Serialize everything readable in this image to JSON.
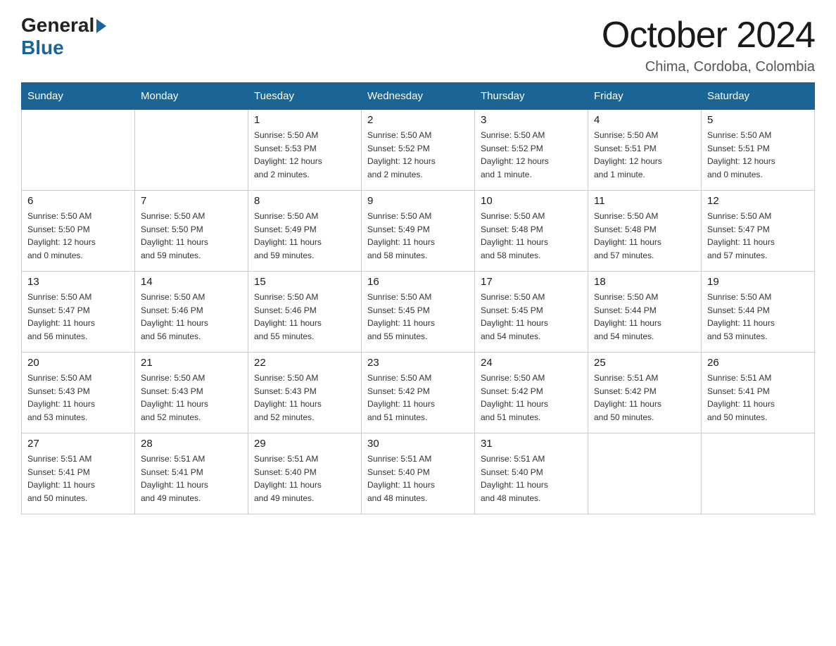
{
  "header": {
    "month_title": "October 2024",
    "location": "Chima, Cordoba, Colombia",
    "logo_general": "General",
    "logo_blue": "Blue"
  },
  "days_of_week": [
    "Sunday",
    "Monday",
    "Tuesday",
    "Wednesday",
    "Thursday",
    "Friday",
    "Saturday"
  ],
  "weeks": [
    [
      {
        "day": "",
        "info": ""
      },
      {
        "day": "",
        "info": ""
      },
      {
        "day": "1",
        "info": "Sunrise: 5:50 AM\nSunset: 5:53 PM\nDaylight: 12 hours\nand 2 minutes."
      },
      {
        "day": "2",
        "info": "Sunrise: 5:50 AM\nSunset: 5:52 PM\nDaylight: 12 hours\nand 2 minutes."
      },
      {
        "day": "3",
        "info": "Sunrise: 5:50 AM\nSunset: 5:52 PM\nDaylight: 12 hours\nand 1 minute."
      },
      {
        "day": "4",
        "info": "Sunrise: 5:50 AM\nSunset: 5:51 PM\nDaylight: 12 hours\nand 1 minute."
      },
      {
        "day": "5",
        "info": "Sunrise: 5:50 AM\nSunset: 5:51 PM\nDaylight: 12 hours\nand 0 minutes."
      }
    ],
    [
      {
        "day": "6",
        "info": "Sunrise: 5:50 AM\nSunset: 5:50 PM\nDaylight: 12 hours\nand 0 minutes."
      },
      {
        "day": "7",
        "info": "Sunrise: 5:50 AM\nSunset: 5:50 PM\nDaylight: 11 hours\nand 59 minutes."
      },
      {
        "day": "8",
        "info": "Sunrise: 5:50 AM\nSunset: 5:49 PM\nDaylight: 11 hours\nand 59 minutes."
      },
      {
        "day": "9",
        "info": "Sunrise: 5:50 AM\nSunset: 5:49 PM\nDaylight: 11 hours\nand 58 minutes."
      },
      {
        "day": "10",
        "info": "Sunrise: 5:50 AM\nSunset: 5:48 PM\nDaylight: 11 hours\nand 58 minutes."
      },
      {
        "day": "11",
        "info": "Sunrise: 5:50 AM\nSunset: 5:48 PM\nDaylight: 11 hours\nand 57 minutes."
      },
      {
        "day": "12",
        "info": "Sunrise: 5:50 AM\nSunset: 5:47 PM\nDaylight: 11 hours\nand 57 minutes."
      }
    ],
    [
      {
        "day": "13",
        "info": "Sunrise: 5:50 AM\nSunset: 5:47 PM\nDaylight: 11 hours\nand 56 minutes."
      },
      {
        "day": "14",
        "info": "Sunrise: 5:50 AM\nSunset: 5:46 PM\nDaylight: 11 hours\nand 56 minutes."
      },
      {
        "day": "15",
        "info": "Sunrise: 5:50 AM\nSunset: 5:46 PM\nDaylight: 11 hours\nand 55 minutes."
      },
      {
        "day": "16",
        "info": "Sunrise: 5:50 AM\nSunset: 5:45 PM\nDaylight: 11 hours\nand 55 minutes."
      },
      {
        "day": "17",
        "info": "Sunrise: 5:50 AM\nSunset: 5:45 PM\nDaylight: 11 hours\nand 54 minutes."
      },
      {
        "day": "18",
        "info": "Sunrise: 5:50 AM\nSunset: 5:44 PM\nDaylight: 11 hours\nand 54 minutes."
      },
      {
        "day": "19",
        "info": "Sunrise: 5:50 AM\nSunset: 5:44 PM\nDaylight: 11 hours\nand 53 minutes."
      }
    ],
    [
      {
        "day": "20",
        "info": "Sunrise: 5:50 AM\nSunset: 5:43 PM\nDaylight: 11 hours\nand 53 minutes."
      },
      {
        "day": "21",
        "info": "Sunrise: 5:50 AM\nSunset: 5:43 PM\nDaylight: 11 hours\nand 52 minutes."
      },
      {
        "day": "22",
        "info": "Sunrise: 5:50 AM\nSunset: 5:43 PM\nDaylight: 11 hours\nand 52 minutes."
      },
      {
        "day": "23",
        "info": "Sunrise: 5:50 AM\nSunset: 5:42 PM\nDaylight: 11 hours\nand 51 minutes."
      },
      {
        "day": "24",
        "info": "Sunrise: 5:50 AM\nSunset: 5:42 PM\nDaylight: 11 hours\nand 51 minutes."
      },
      {
        "day": "25",
        "info": "Sunrise: 5:51 AM\nSunset: 5:42 PM\nDaylight: 11 hours\nand 50 minutes."
      },
      {
        "day": "26",
        "info": "Sunrise: 5:51 AM\nSunset: 5:41 PM\nDaylight: 11 hours\nand 50 minutes."
      }
    ],
    [
      {
        "day": "27",
        "info": "Sunrise: 5:51 AM\nSunset: 5:41 PM\nDaylight: 11 hours\nand 50 minutes."
      },
      {
        "day": "28",
        "info": "Sunrise: 5:51 AM\nSunset: 5:41 PM\nDaylight: 11 hours\nand 49 minutes."
      },
      {
        "day": "29",
        "info": "Sunrise: 5:51 AM\nSunset: 5:40 PM\nDaylight: 11 hours\nand 49 minutes."
      },
      {
        "day": "30",
        "info": "Sunrise: 5:51 AM\nSunset: 5:40 PM\nDaylight: 11 hours\nand 48 minutes."
      },
      {
        "day": "31",
        "info": "Sunrise: 5:51 AM\nSunset: 5:40 PM\nDaylight: 11 hours\nand 48 minutes."
      },
      {
        "day": "",
        "info": ""
      },
      {
        "day": "",
        "info": ""
      }
    ]
  ]
}
